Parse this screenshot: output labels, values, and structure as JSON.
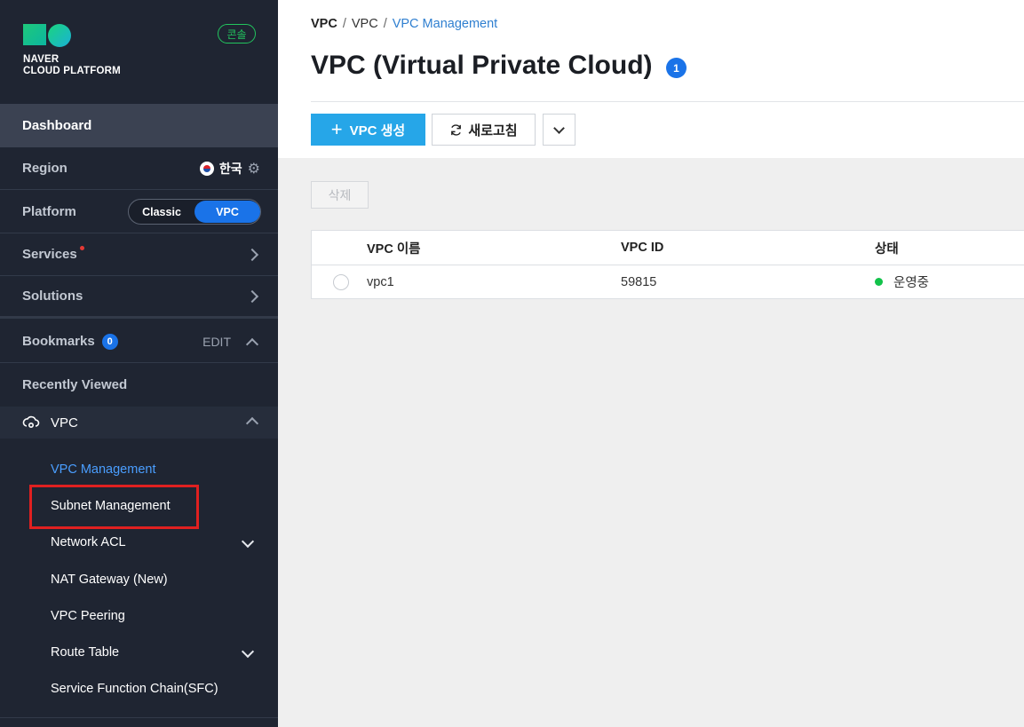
{
  "brand": {
    "line1": "NAVER",
    "line2": "CLOUD PLATFORM",
    "console_badge": "콘솔"
  },
  "sidebar": {
    "dashboard": "Dashboard",
    "region": {
      "label": "Region",
      "value": "한국"
    },
    "platform": {
      "label": "Platform",
      "options": [
        "Classic",
        "VPC"
      ],
      "selected": "VPC"
    },
    "services": "Services",
    "solutions": "Solutions",
    "bookmarks": {
      "label": "Bookmarks",
      "count": "0",
      "edit": "EDIT"
    },
    "recent": "Recently Viewed",
    "vpc_section": "VPC",
    "vpc_items": [
      "VPC Management",
      "Subnet Management",
      "Network ACL",
      "NAT Gateway (New)",
      "VPC Peering",
      "Route Table",
      "Service Function Chain(SFC)"
    ]
  },
  "breadcrumb": [
    "VPC",
    "VPC",
    "VPC Management"
  ],
  "page": {
    "title": "VPC (Virtual Private Cloud)",
    "count": "1"
  },
  "toolbar": {
    "create": "VPC 생성",
    "refresh": "새로고침",
    "delete": "삭제"
  },
  "table": {
    "headers": [
      "VPC 이름",
      "VPC ID",
      "상태"
    ],
    "rows": [
      {
        "name": "vpc1",
        "id": "59815",
        "status": "운영중"
      }
    ]
  },
  "colors": {
    "accent": "#1a73e8",
    "create_button": "#26a6e8",
    "status_running": "#12c24a",
    "highlight": "#e02020",
    "sidebar_bg": "#1f2532"
  }
}
